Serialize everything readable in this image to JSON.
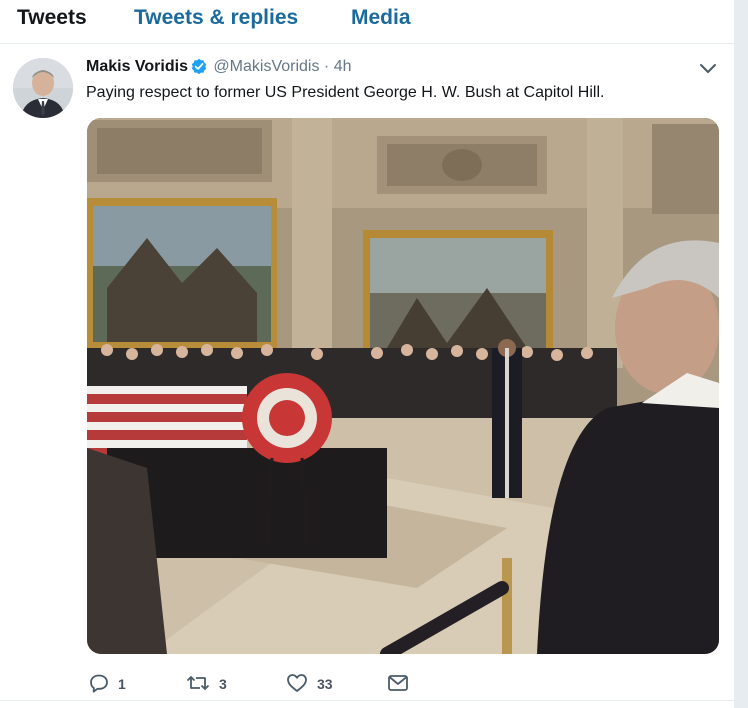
{
  "tabs": [
    {
      "label": "Tweets",
      "active": true
    },
    {
      "label": "Tweets & replies",
      "active": false
    },
    {
      "label": "Media",
      "active": false
    }
  ],
  "tweet": {
    "author_name": "Makis Voridis",
    "verified": true,
    "handle": "@MakisVoridis",
    "separator": "·",
    "time": "4h",
    "text": "Paying respect to former US President George H. W. Bush at Capitol Hill.",
    "actions": {
      "reply_count": "1",
      "retweet_count": "3",
      "like_count": "33"
    }
  },
  "icons": {
    "verified": "verified-badge-icon",
    "caret": "chevron-down-icon",
    "reply": "reply-icon",
    "retweet": "retweet-icon",
    "like": "heart-icon",
    "dm": "envelope-icon"
  },
  "colors": {
    "link_blue": "#1b6a9c",
    "verified_blue": "#1da1f2",
    "muted_gray": "#657786",
    "border": "#e6ecf0"
  }
}
